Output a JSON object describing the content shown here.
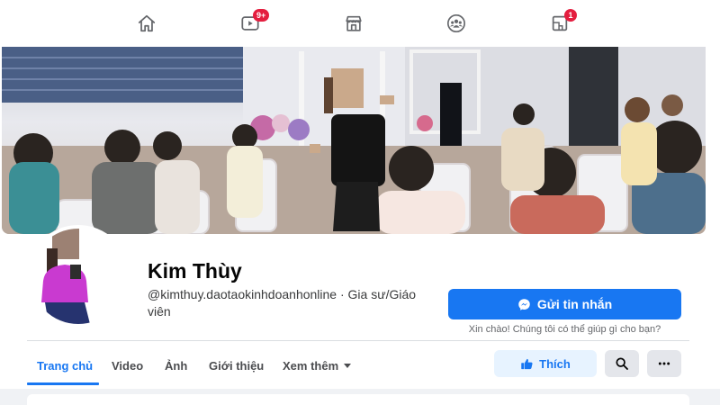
{
  "topnav": {
    "items": [
      {
        "icon": "home-icon",
        "badge": ""
      },
      {
        "icon": "video-icon",
        "badge": "9+"
      },
      {
        "icon": "marketplace-icon",
        "badge": ""
      },
      {
        "icon": "groups-icon",
        "badge": ""
      },
      {
        "icon": "gaming-icon",
        "badge": "1"
      }
    ]
  },
  "profile": {
    "name": "Kim Thùy",
    "handle_line": "@kimthuy.daotaokinhdoanhonline · Gia sư/Giáo viên"
  },
  "actions": {
    "message_label": "Gửi tin nhắn",
    "greeting": "Xin chào! Chúng tôi có thể giúp gì cho bạn?",
    "like_label": "Thích"
  },
  "tabs": [
    {
      "label": "Trang chủ",
      "active": true
    },
    {
      "label": "Video",
      "active": false
    },
    {
      "label": "Ảnh",
      "active": false
    },
    {
      "label": "Giới thiệu",
      "active": false
    },
    {
      "label": "Xem thêm",
      "active": false
    }
  ],
  "colors": {
    "accent": "#1877f2",
    "badge": "#e41e3f",
    "like_bg": "#e7f3ff",
    "icon_button_bg": "#e4e6eb"
  }
}
